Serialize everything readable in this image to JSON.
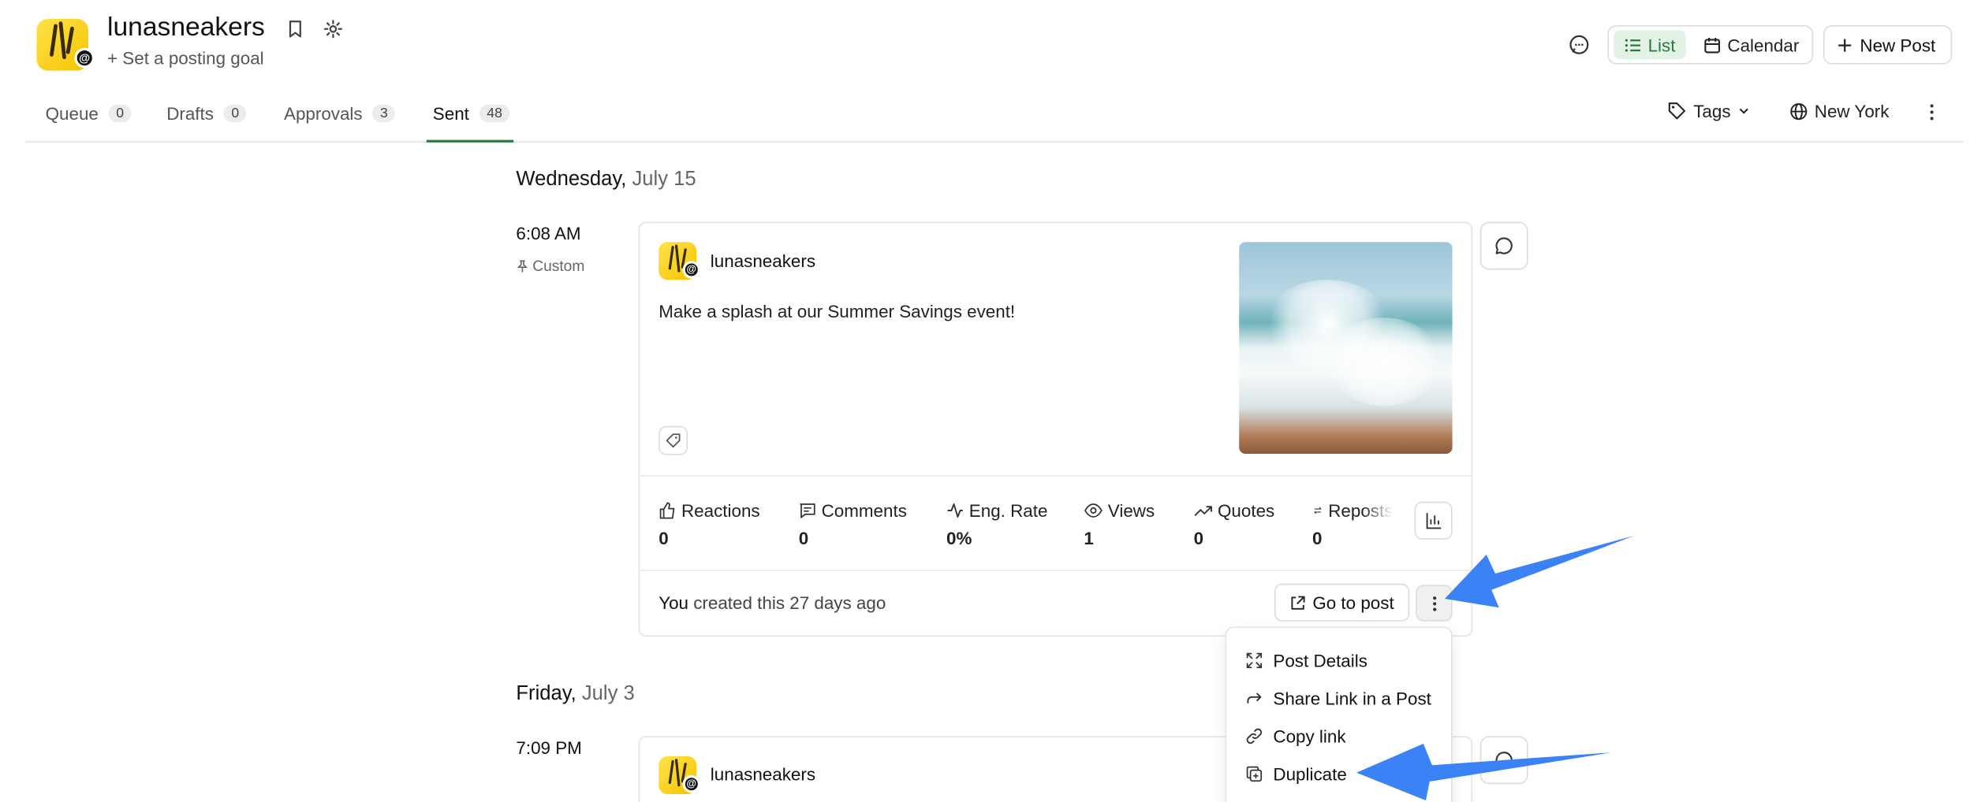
{
  "header": {
    "account_name": "lunasneakers",
    "posting_goal": "+ Set a posting goal",
    "view_list_label": "List",
    "view_calendar_label": "Calendar",
    "new_post_label": "New Post"
  },
  "tabs": [
    {
      "label": "Queue",
      "count": "0"
    },
    {
      "label": "Drafts",
      "count": "0"
    },
    {
      "label": "Approvals",
      "count": "3"
    },
    {
      "label": "Sent",
      "count": "48",
      "active": true
    }
  ],
  "toolbar": {
    "tags_label": "Tags",
    "timezone_label": "New York"
  },
  "days": [
    {
      "weekday": "Wednesday,",
      "date": "July 15",
      "post": {
        "time": "6:08 AM",
        "schedule_type": "Custom",
        "handle": "lunasneakers",
        "text": "Make a splash at our Summer Savings event!",
        "metrics": [
          {
            "label": "Reactions",
            "value": "0"
          },
          {
            "label": "Comments",
            "value": "0"
          },
          {
            "label": "Eng. Rate",
            "value": "0%"
          },
          {
            "label": "Views",
            "value": "1"
          },
          {
            "label": "Quotes",
            "value": "0"
          },
          {
            "label": "Reposts",
            "value": "0"
          }
        ],
        "created_by": "You",
        "created_text": "created this 27 days ago",
        "go_to_post_label": "Go to post"
      }
    },
    {
      "weekday": "Friday,",
      "date": "July 3",
      "post": {
        "time": "7:09 PM",
        "handle": "lunasneakers"
      }
    }
  ],
  "context_menu": {
    "items": [
      {
        "label": "Post Details",
        "icon": "expand-icon"
      },
      {
        "label": "Share Link in a Post",
        "icon": "share-arrow-icon"
      },
      {
        "label": "Copy link",
        "icon": "link-icon"
      },
      {
        "label": "Duplicate",
        "icon": "duplicate-icon"
      }
    ]
  },
  "colors": {
    "accent_green": "#2b7a3d",
    "annotation_arrow": "#3b82f6"
  }
}
